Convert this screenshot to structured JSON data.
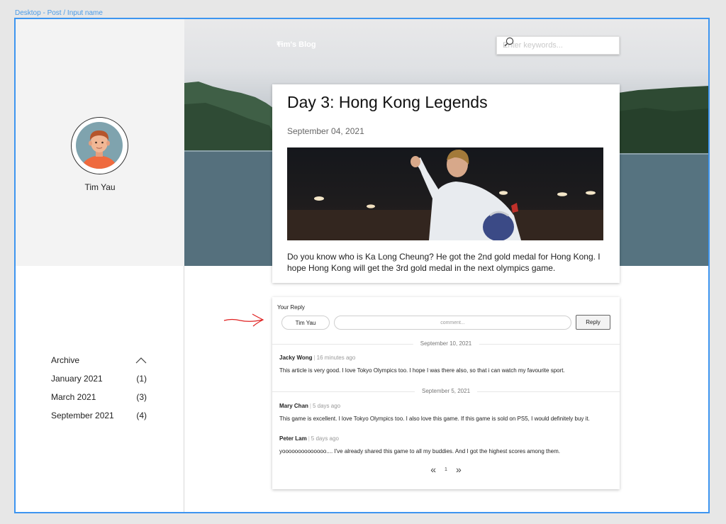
{
  "frame_label": "Desktop - Post / Input name",
  "profile": {
    "name": "Tim Yau"
  },
  "archive": {
    "title": "Archive",
    "items": [
      {
        "label": "January 2021",
        "count": "(1)"
      },
      {
        "label": "March 2021",
        "count": "(3)"
      },
      {
        "label": "September 2021",
        "count": "(4)"
      }
    ]
  },
  "header": {
    "back_label": "Tim's Blog",
    "search_placeholder": "Enter keywords..."
  },
  "post": {
    "title": "Day 3: Hong Kong Legends",
    "date": "September 04, 2021",
    "body": "Do you know who is Ka Long Cheung? He got the 2nd gold medal for Hong Kong. I hope Hong Kong will get the 3rd gold medal in the next olympics game."
  },
  "reply": {
    "label": "Your Reply",
    "name": "Tim Yau",
    "comment_placeholder": "comment...",
    "button": "Reply"
  },
  "comment_groups": [
    {
      "date": "September 10, 2021",
      "comments": [
        {
          "author": "Jacky Wong",
          "time": "16 minutes ago",
          "text": "This article is very good. I love Tokyo Olympics too. I hope I was there also, so that i can watch my favourite sport."
        }
      ]
    },
    {
      "date": "September 5, 2021",
      "comments": [
        {
          "author": "Mary Chan",
          "time": "5 days ago",
          "text": "This game is excellent. I love Tokyo Olympics too. I also love this game. If this game is sold on PS5, I would definitely buy it."
        },
        {
          "author": "Peter Lam",
          "time": "5 days ago",
          "text": "yoooooooooooooo.... I've already shared this game to all my buddies. And I got the highest scores among them."
        }
      ]
    }
  ],
  "pagination": {
    "prev": "«",
    "page": "1",
    "next": "»"
  },
  "colors": {
    "frame": "#3d95f0",
    "annotation": "#e02020"
  }
}
